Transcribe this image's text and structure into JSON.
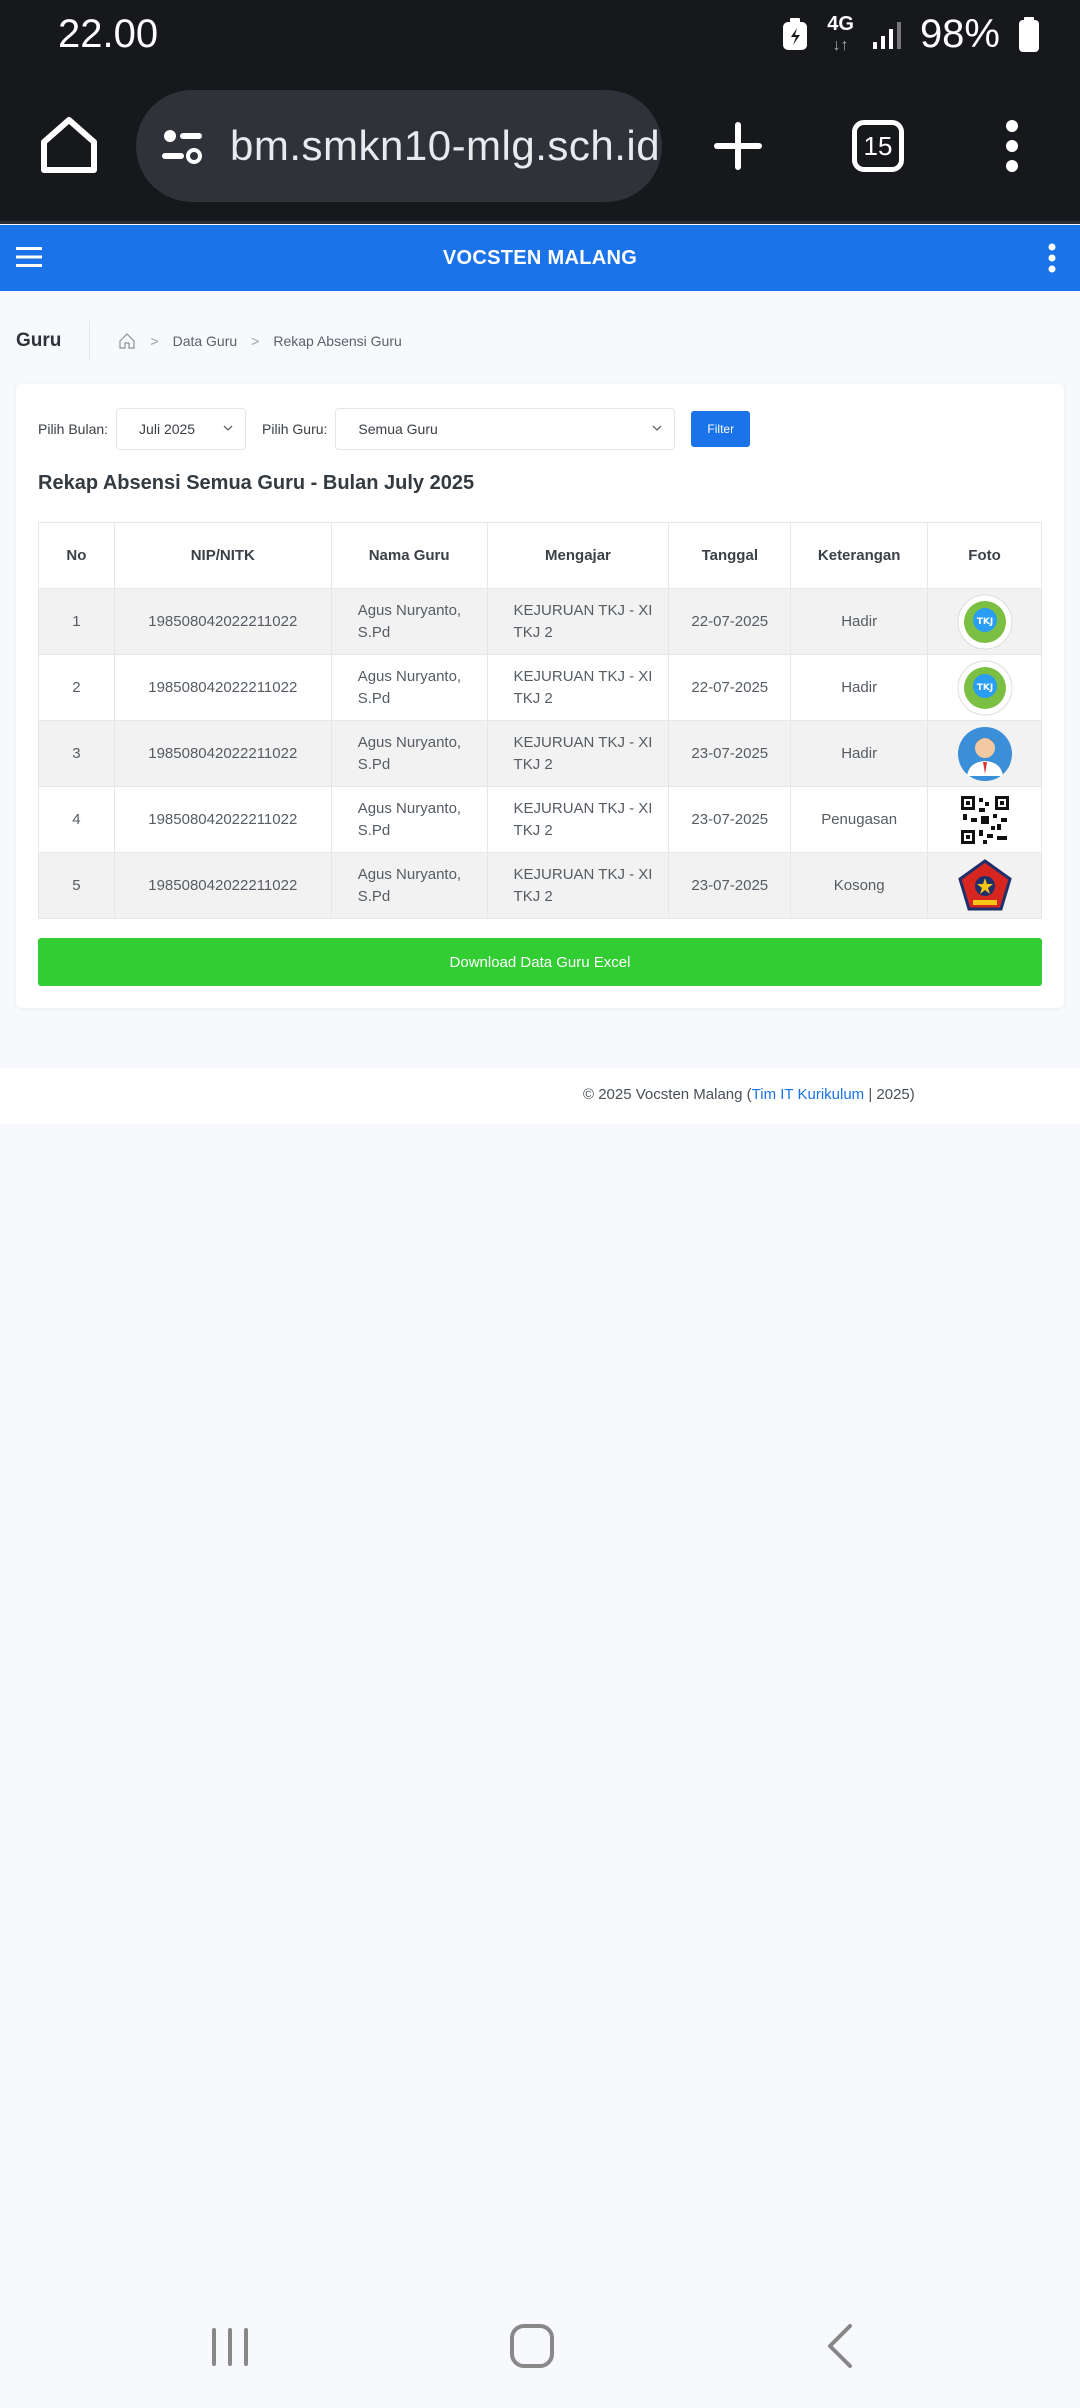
{
  "status": {
    "time": "22.00",
    "network": "4G",
    "battery": "98%"
  },
  "browser": {
    "url": "bm.smkn10-mlg.sch.id",
    "tab_count": "15"
  },
  "app": {
    "title": "VOCSTEN MALANG"
  },
  "breadcrumb": {
    "page": "Guru",
    "items": [
      "Data Guru",
      "Rekap Absensi Guru"
    ]
  },
  "filters": {
    "bulan_label": "Pilih Bulan:",
    "bulan_value": "Juli 2025",
    "guru_label": "Pilih Guru:",
    "guru_value": "Semua Guru",
    "button": "Filter"
  },
  "heading": "Rekap Absensi Semua Guru - Bulan July 2025",
  "table": {
    "headers": [
      "No",
      "NIP/NITK",
      "Nama Guru",
      "Mengajar",
      "Tanggal",
      "Keterangan",
      "Foto"
    ],
    "rows": [
      {
        "no": "1",
        "nip": "198508042022211022",
        "nama": "Agus Nuryanto, S.Pd",
        "mengajar": "KEJURUAN TKJ - XI TKJ 2",
        "tanggal": "22-07-2025",
        "keterangan": "Hadir",
        "foto": "tkj-logo-image"
      },
      {
        "no": "2",
        "nip": "198508042022211022",
        "nama": "Agus Nuryanto, S.Pd",
        "mengajar": "KEJURUAN TKJ - XI TKJ 2",
        "tanggal": "22-07-2025",
        "keterangan": "Hadir",
        "foto": "tkj-logo-image"
      },
      {
        "no": "3",
        "nip": "198508042022211022",
        "nama": "Agus Nuryanto, S.Pd",
        "mengajar": "KEJURUAN TKJ - XI TKJ 2",
        "tanggal": "23-07-2025",
        "keterangan": "Hadir",
        "foto": "person-avatar-image"
      },
      {
        "no": "4",
        "nip": "198508042022211022",
        "nama": "Agus Nuryanto, S.Pd",
        "mengajar": "KEJURUAN TKJ - XI TKJ 2",
        "tanggal": "23-07-2025",
        "keterangan": "Penugasan",
        "foto": "qr-code-image"
      },
      {
        "no": "5",
        "nip": "198508042022211022",
        "nama": "Agus Nuryanto, S.Pd",
        "mengajar": "KEJURUAN TKJ - XI TKJ 2",
        "tanggal": "23-07-2025",
        "keterangan": "Kosong",
        "foto": "red-pentagon-logo-image"
      }
    ]
  },
  "download_button": "Download Data Guru Excel",
  "footer": {
    "prefix": "© 2025 Vocsten Malang (",
    "link": "Tim IT Kurikulum",
    "suffix": " | 2025)"
  },
  "colors": {
    "primary": "#1a73e8",
    "success": "#32cd32",
    "dark": "#17181c"
  }
}
